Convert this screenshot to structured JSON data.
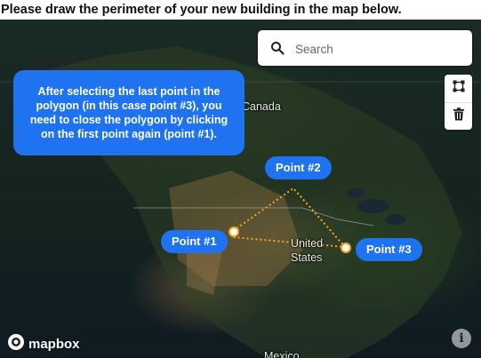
{
  "page": {
    "heading": "Please draw the perimeter of your new building in the map below."
  },
  "search": {
    "placeholder": "Search",
    "icon": "search-icon"
  },
  "draw_tools": {
    "polygon_icon": "polygon-draw-icon",
    "trash_icon": "trash-icon"
  },
  "callout": {
    "text": "After selecting the last point in the polygon (in this case point #3), you need to close the polygon by clicking on the first point again (point #1)."
  },
  "map_labels": {
    "canada": "Canada",
    "united": "United",
    "states": "States",
    "mexico": "Mexico"
  },
  "points": [
    {
      "label": "Point #1"
    },
    {
      "label": "Point #2"
    },
    {
      "label": "Point #3"
    }
  ],
  "attribution": {
    "logo_text": "mapbox",
    "info_label": "i"
  },
  "colors": {
    "accent_blue": "#1f72f0",
    "polygon_line": "#f5a623"
  }
}
